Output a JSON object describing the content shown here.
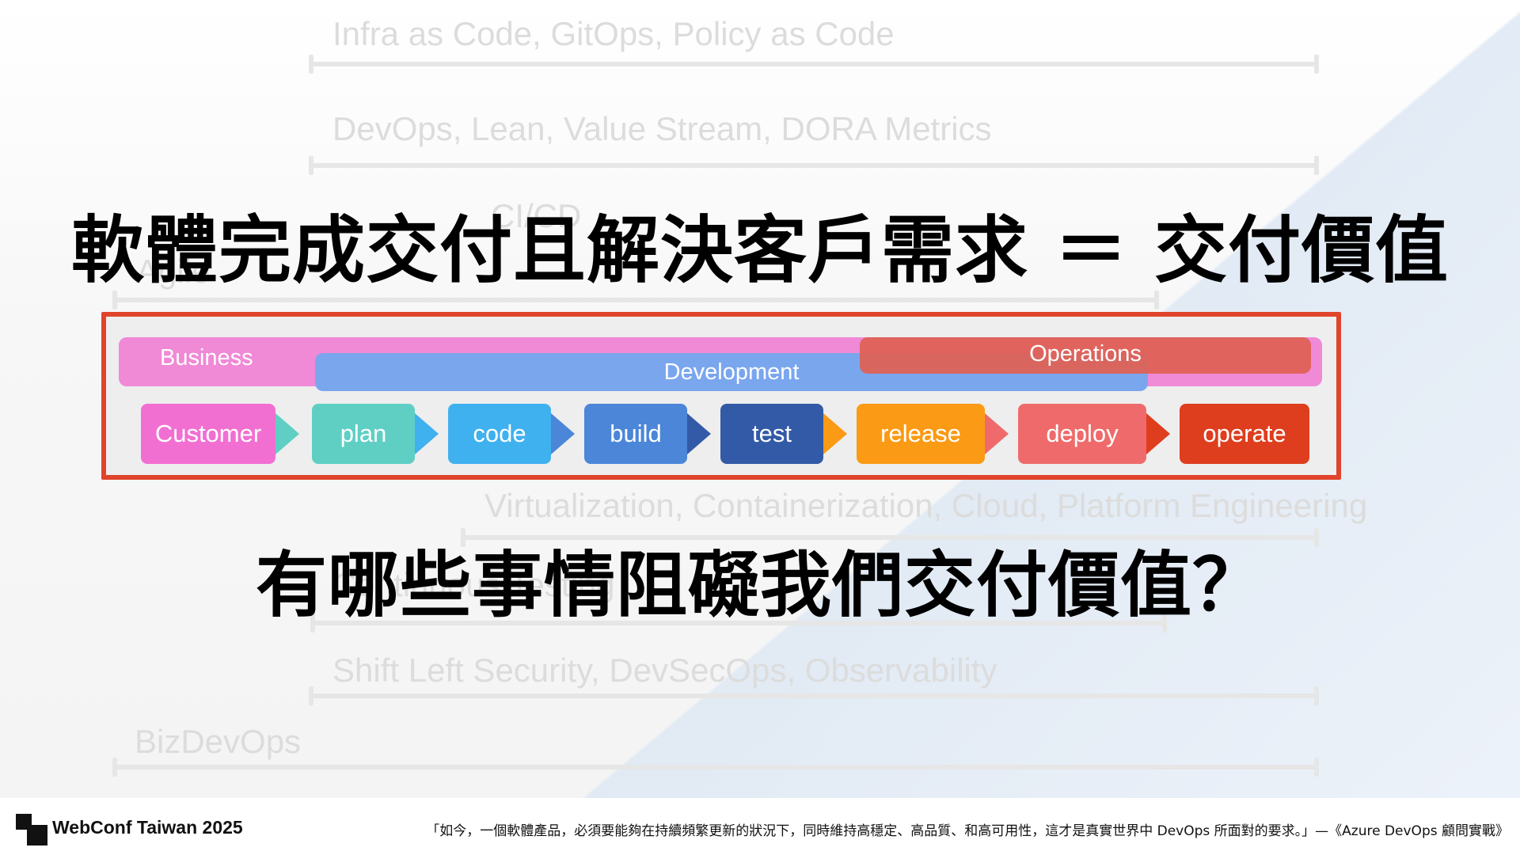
{
  "background_labels": [
    "Infra as Code, GitOps, Policy as Code",
    "DevOps, Lean, Value Stream, DORA Metrics",
    "CI/CD",
    "Agile",
    "Virtualization, Containerization, Cloud, Platform Engineering",
    "Continuous Testing",
    "Shift Left Security, DevSecOps, Observability",
    "BizDevOps"
  ],
  "headline": "軟體完成交付且解決客戶需求 ＝ 交付價值",
  "question": "有哪些事情阻礙我們交付價值？",
  "diagram": {
    "bands": {
      "business": "Business",
      "development": "Development",
      "operations": "Operations"
    },
    "stages": [
      {
        "label": "Customer",
        "color": "#f26fd2"
      },
      {
        "label": "plan",
        "color": "#5fcfc4"
      },
      {
        "label": "code",
        "color": "#3fb1ef"
      },
      {
        "label": "build",
        "color": "#4b86d8"
      },
      {
        "label": "test",
        "color": "#335aa6"
      },
      {
        "label": "release",
        "color": "#fb9a14"
      },
      {
        "label": "deploy",
        "color": "#ef6b6b"
      },
      {
        "label": "operate",
        "color": "#de3e1e"
      }
    ],
    "frame_color": "#e0442b"
  },
  "footer": {
    "brand": "WebConf Taiwan 2025",
    "quote": "「如今，一個軟體產品，必須要能夠在持續頻繁更新的狀況下，同時維持高穩定、高品質、和高可用性，這才是真實世界中 DevOps 所面對的要求。」—《Azure DevOps 顧問實戰》"
  }
}
